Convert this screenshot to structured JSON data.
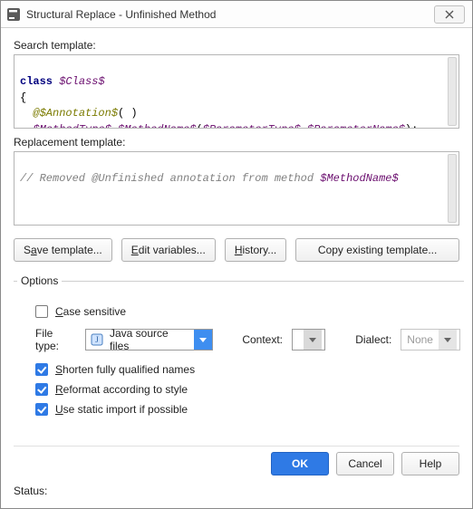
{
  "window": {
    "title": "Structural Replace - Unfinished Method"
  },
  "labels": {
    "search_template": "Search template:",
    "replacement_template": "Replacement template:",
    "options_legend": "Options",
    "file_type": "File type:",
    "context": "Context:",
    "dialect": "Dialect:",
    "status": "Status:"
  },
  "search_code": {
    "t_class": "class ",
    "v_class": "$Class$",
    "brace_open": "{",
    "at": "@",
    "v_annotation": "$Annotation$",
    "paren": "( )",
    "v_method_type": "$MethodType$",
    "sp": " ",
    "v_method_name": "$MethodName$",
    "open_p": "(",
    "v_param_type": "$ParameterType$",
    "v_param_name": "$ParameterName$",
    "close_p": ")",
    "semi": ";",
    "brace_close": "}"
  },
  "replacement_code": {
    "comment_prefix": "// Removed @Unfinished annotation from method ",
    "v_method_name": "$MethodName$"
  },
  "buttons": {
    "save_template_pre": "S",
    "save_template_u": "a",
    "save_template_post": "ve template...",
    "edit_vars_pre": "",
    "edit_vars_u": "E",
    "edit_vars_post": "dit variables...",
    "history_pre": "",
    "history_u": "H",
    "history_post": "istory...",
    "copy_template": "Copy existing template...",
    "ok": "OK",
    "cancel": "Cancel",
    "help": "Help"
  },
  "options": {
    "case_sensitive_pre": "",
    "case_sensitive_u": "C",
    "case_sensitive_post": "ase sensitive",
    "case_sensitive_checked": false,
    "shorten_pre": "",
    "shorten_u": "S",
    "shorten_post": "horten fully qualified names",
    "shorten_checked": true,
    "reformat_pre": "",
    "reformat_u": "R",
    "reformat_post": "eformat according to style",
    "reformat_checked": true,
    "static_import_pre": "",
    "static_import_u": "U",
    "static_import_post": "se static import if possible",
    "static_import_checked": true
  },
  "combos": {
    "file_type_value": "Java source files",
    "context_value": "",
    "dialect_value": "None"
  }
}
